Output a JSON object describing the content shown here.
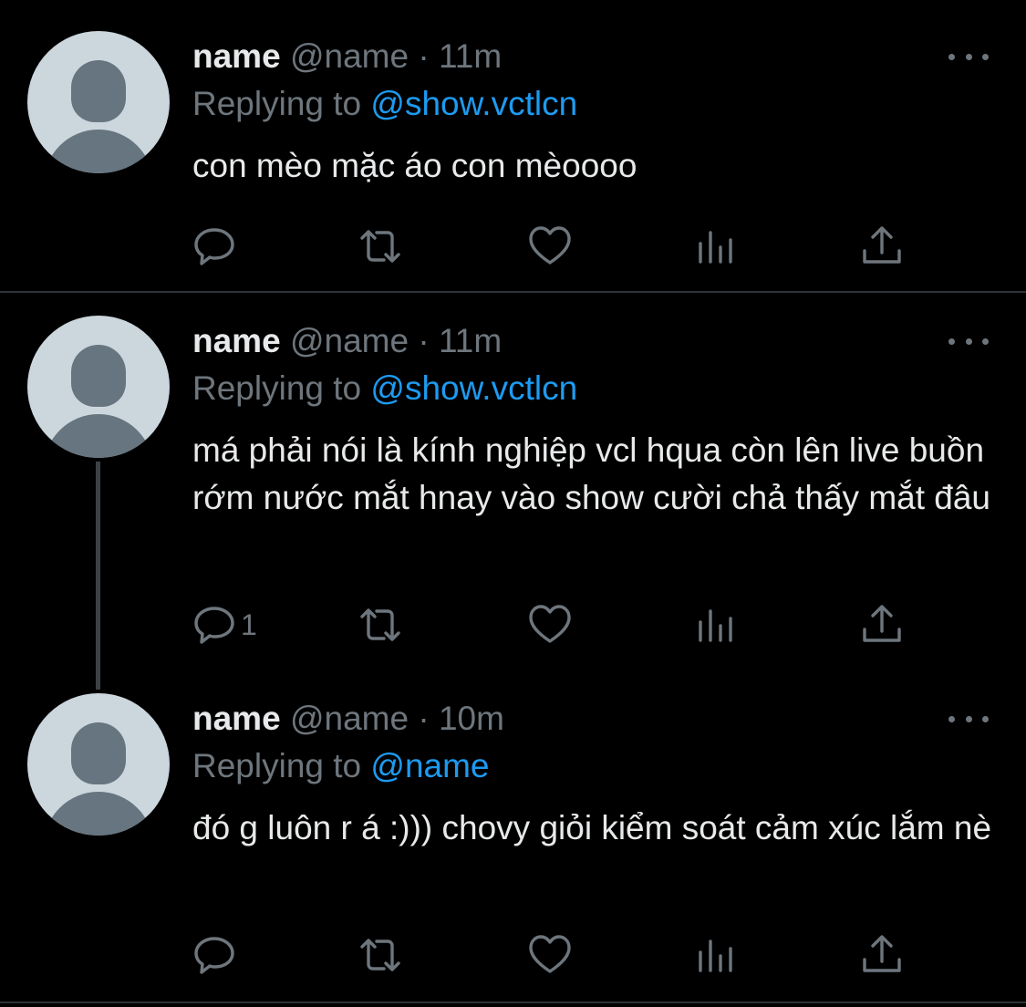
{
  "tweets": [
    {
      "display_name": "name",
      "handle": "@name",
      "separator": "·",
      "time": "11m",
      "replying_label": "Replying to",
      "replying_to": "@show.vctlcn",
      "text": "con mèo mặc áo con mèoooo",
      "reply_count": ""
    },
    {
      "display_name": "name",
      "handle": "@name",
      "separator": "·",
      "time": "11m",
      "replying_label": "Replying to",
      "replying_to": "@show.vctlcn",
      "text": "má phải nói là kính nghiệp vcl hqua còn lên live buồn rớm nước mắt hnay vào show cười chả thấy mắt đâu",
      "reply_count": "1"
    },
    {
      "display_name": "name",
      "handle": "@name",
      "separator": "·",
      "time": "10m",
      "replying_label": "Replying to",
      "replying_to": "@name",
      "text": "đó g luôn r á :))) chovy giỏi kiểm soát cảm xúc lắm nè",
      "reply_count": ""
    }
  ],
  "icons": {
    "reply": "reply-icon",
    "retweet": "retweet-icon",
    "like": "heart-icon",
    "analytics": "analytics-icon",
    "share": "share-icon",
    "more": "more-icon"
  },
  "colors": {
    "background": "#000000",
    "text": "#e7e9ea",
    "muted": "#6e767d",
    "accent": "#1d9bf0",
    "avatar_bg": "#ccd6dd",
    "avatar_fg": "#66757f",
    "divider": "#2f3336"
  }
}
